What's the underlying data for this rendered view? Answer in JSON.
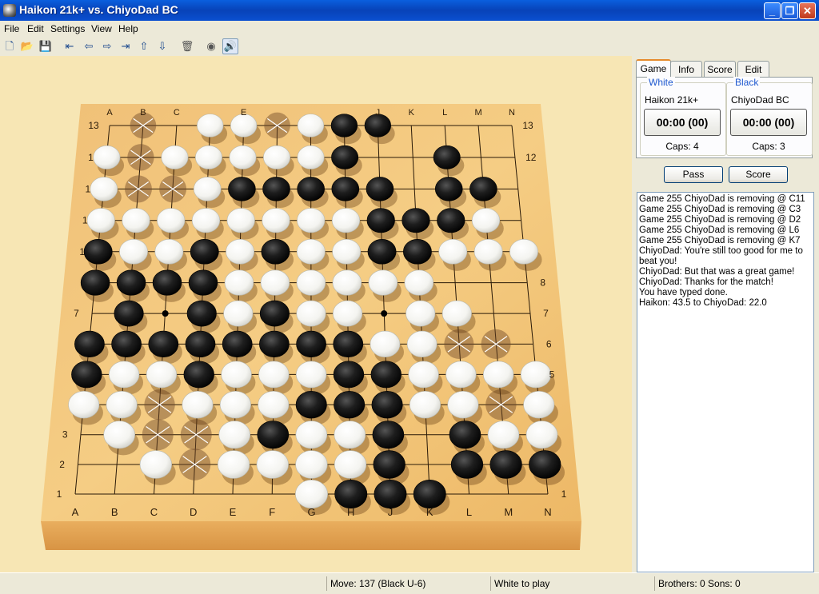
{
  "window": {
    "title": "Haikon 21k+ vs. ChiyoDad BC"
  },
  "menu": [
    "File",
    "Edit",
    "Settings",
    "View",
    "Help"
  ],
  "toolbar": {
    "icons": [
      "new-file-icon",
      "open-folder-icon",
      "save-icon",
      "first-move-icon",
      "previous-move-icon",
      "next-move-icon",
      "last-move-icon",
      "up-variation-icon",
      "down-variation-icon",
      "delete-icon",
      "stone-icon",
      "sound-icon"
    ]
  },
  "tabs": [
    "Game",
    "Info",
    "Score",
    "Edit"
  ],
  "white": {
    "legend": "White",
    "name": "Haikon 21k+",
    "clock": "00:00 (00)",
    "caps": "Caps:  4"
  },
  "black": {
    "legend": "Black",
    "name": "ChiyoDad BC",
    "clock": "00:00 (00)",
    "caps": "Caps:  3"
  },
  "buttons": {
    "pass": "Pass",
    "score": "Score"
  },
  "chat": [
    "Game 255 ChiyoDad is removing @ C11",
    "Game 255 ChiyoDad is removing @ C3",
    "Game 255 ChiyoDad is removing @ D2",
    "Game 255 ChiyoDad is removing @ L6",
    "Game 255 ChiyoDad is removing @ K7",
    "ChiyoDad: You're still too good for me to beat you!",
    "ChiyoDad: But that was a great game!",
    "ChiyoDad: Thanks for the match!",
    "You have typed done.",
    "Haikon: 43.5 to ChiyoDad: 22.0"
  ],
  "status": {
    "move": "Move: 137   (Black U-6)",
    "turn": "White to play",
    "tree": "Brothers: 0  Sons: 0"
  },
  "board": {
    "columns": [
      "A",
      "B",
      "C",
      "D",
      "E",
      "F",
      "G",
      "H",
      "J",
      "K",
      "L",
      "M",
      "N"
    ],
    "rows": [
      "13",
      "12",
      "11",
      "10",
      "9",
      "8",
      "7",
      "6",
      "5",
      "4",
      "3",
      "2",
      "1"
    ],
    "rows_top_to_bottom": [
      ".x.WWxWBB....",
      "WxWWWWWB..B..",
      "WxxWBBBBB.BB.",
      "WWWWWWWWBBBW.",
      "BWWBWBWWBBWWW",
      "BBBBWWWWWW...",
      ".B+BWBWW+WW..",
      "BBBBBBBBWWxx.",
      "BWWBWWWBBWWWW",
      "WWxWWWBBBWWxW",
      ".WxxWBWWB.BWW",
      "..WxWWWWB.BBB",
      "......WBBB..."
    ],
    "visible_labels": {
      "top": [
        "A",
        "B",
        "C",
        "E",
        "J",
        "K",
        "L",
        "M",
        "N"
      ],
      "bottom": [
        "A",
        "B",
        "C",
        "D",
        "E",
        "F",
        "G",
        "H",
        "J",
        "K",
        "L",
        "M",
        "N"
      ],
      "left": [
        "13",
        "1",
        "1",
        "1",
        "7",
        "3",
        "2",
        "1"
      ],
      "right": [
        "13",
        "12",
        "8",
        "7",
        "6",
        "5",
        "1"
      ]
    }
  }
}
